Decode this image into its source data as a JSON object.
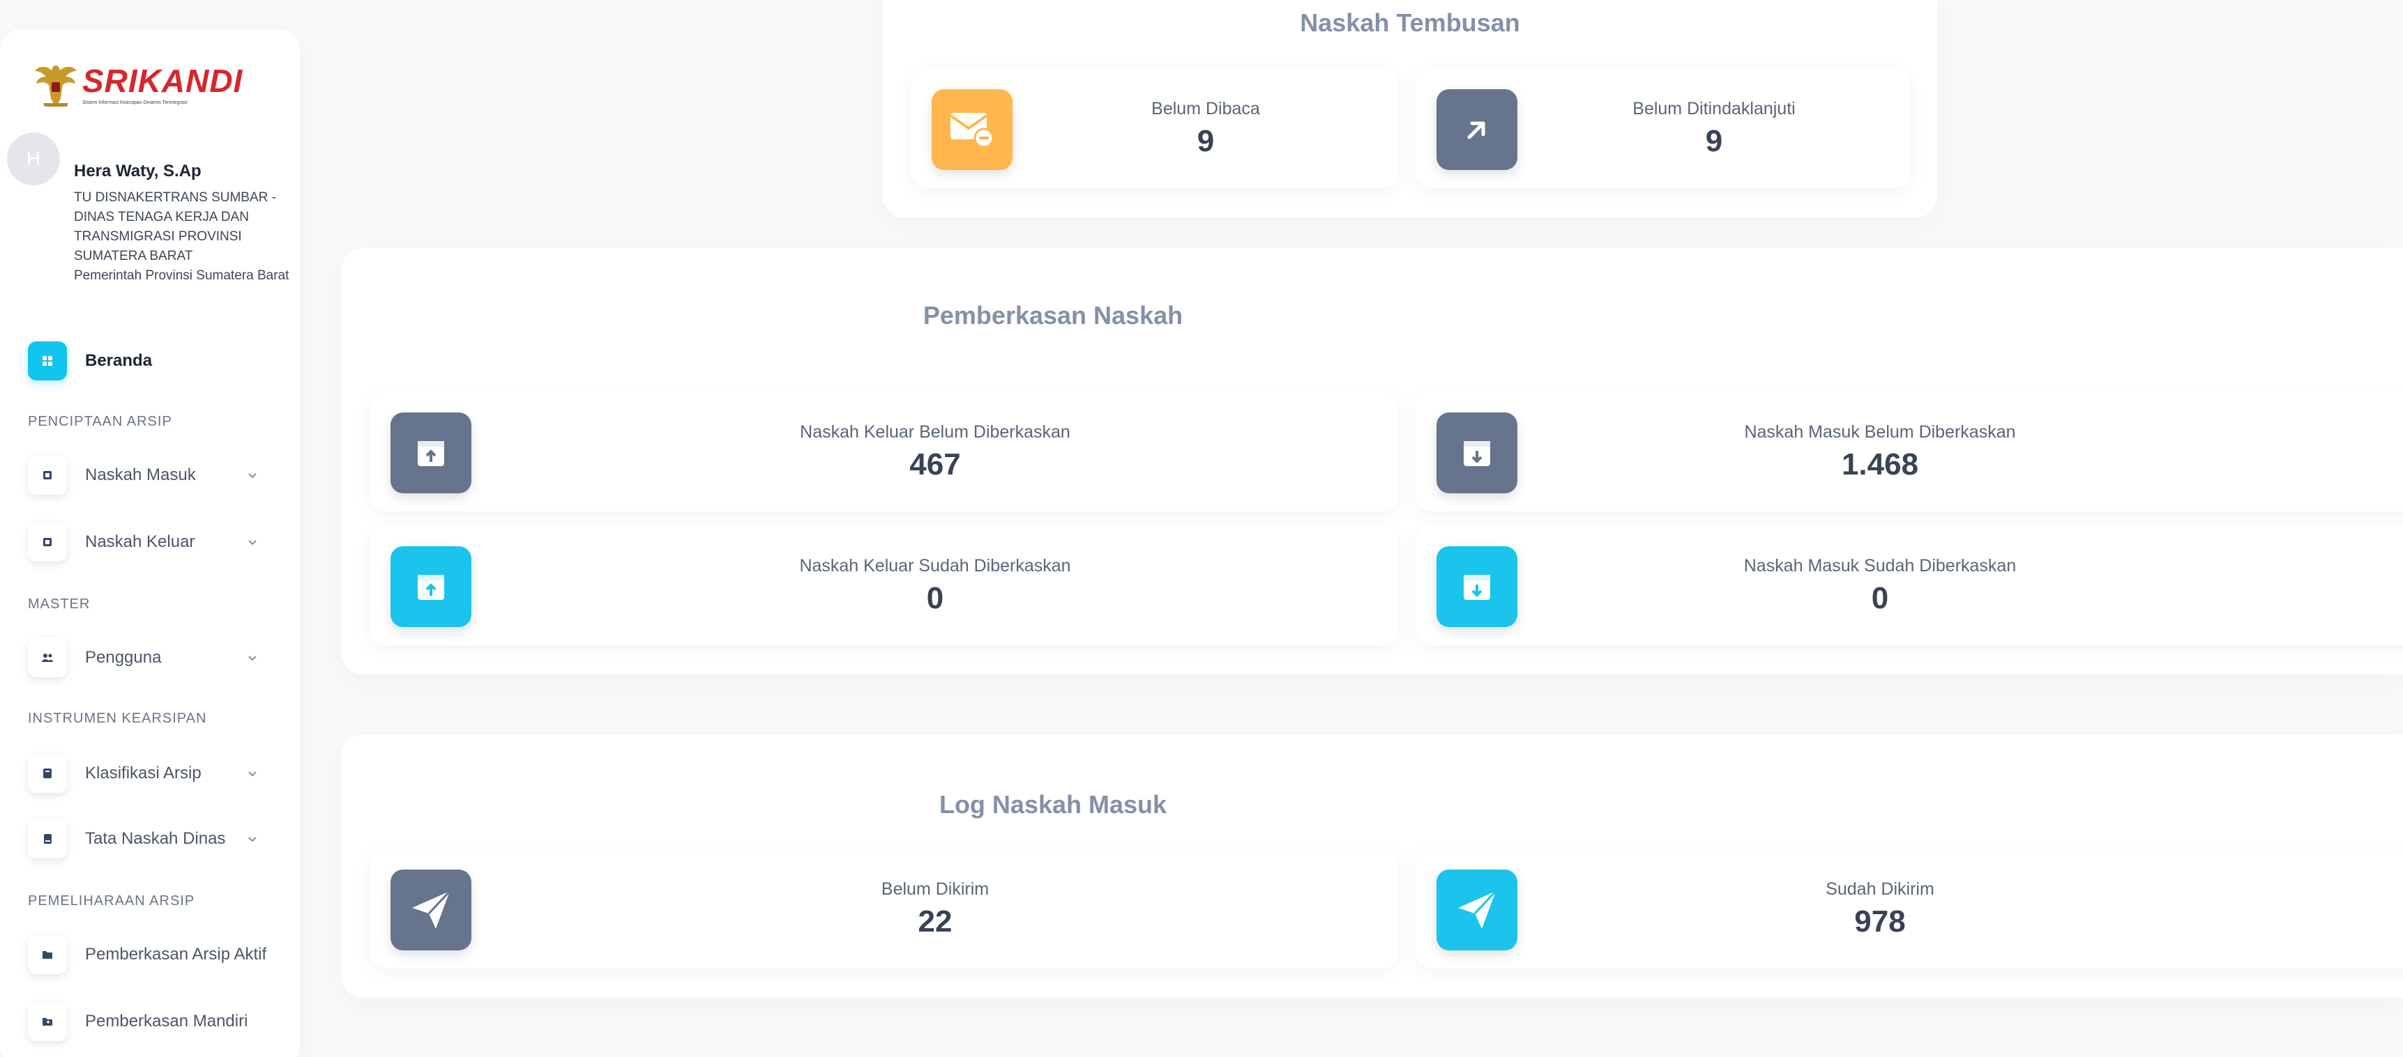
{
  "logo": {
    "title": "SRIKANDI",
    "subtitle": "Sistem Informasi Kearsipan Dinamis Terintegrasi"
  },
  "user": {
    "initial": "H",
    "name": "Hera Waty, S.Ap",
    "unit": "TU DISNAKERTRANS SUMBAR - DINAS TENAGA KERJA DAN TRANSMIGRASI PROVINSI SUMATERA BARAT",
    "org": "Pemerintah Provinsi Sumatera Barat"
  },
  "sidebar": {
    "home": {
      "label": "Beranda",
      "icon": "grid-icon"
    },
    "sections": {
      "penciptaan": "PENCIPTAAN ARSIP",
      "master": "MASTER",
      "instrumen": "INSTRUMEN KEARSIPAN",
      "pemeliharaan": "PEMELIHARAAN ARSIP"
    },
    "items": {
      "naskah_masuk": "Naskah Masuk",
      "naskah_keluar": "Naskah Keluar",
      "pengguna": "Pengguna",
      "klasifikasi": "Klasifikasi Arsip",
      "tata_naskah": "Tata Naskah Dinas",
      "pemberkasan_aktif": "Pemberkasan Arsip Aktif",
      "pemberkasan_mandiri": "Pemberkasan Mandiri"
    }
  },
  "tembusan": {
    "title": "Naskah Tembusan",
    "belum_dibaca": {
      "label": "Belum Dibaca",
      "value": "9"
    },
    "belum_ditindaklanjuti": {
      "label": "Belum Ditindaklanjuti",
      "value": "9"
    }
  },
  "pemberkasan": {
    "title": "Pemberkasan Naskah",
    "keluar_belum": {
      "label": "Naskah Keluar Belum Diberkaskan",
      "value": "467"
    },
    "masuk_belum": {
      "label": "Naskah Masuk Belum Diberkaskan",
      "value": "1.468"
    },
    "keluar_sudah": {
      "label": "Naskah Keluar Sudah Diberkaskan",
      "value": "0"
    },
    "masuk_sudah": {
      "label": "Naskah Masuk Sudah Diberkaskan",
      "value": "0"
    }
  },
  "log": {
    "title": "Log Naskah Masuk",
    "belum_dikirim": {
      "label": "Belum Dikirim",
      "value": "22"
    },
    "sudah_dikirim": {
      "label": "Sudah Dikirim",
      "value": "978"
    }
  },
  "colors": {
    "slate": "#67748e",
    "cyan": "#1ac4ed",
    "orange": "#ffb64c",
    "brand_red": "#d7262c"
  }
}
